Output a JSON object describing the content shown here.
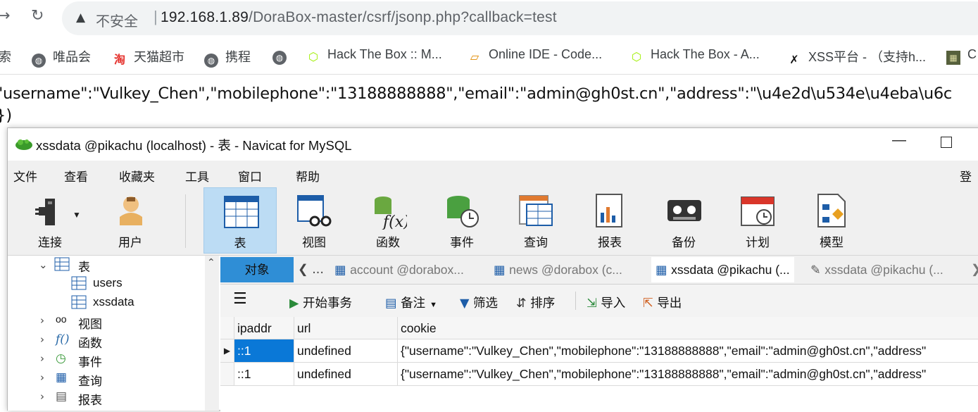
{
  "browser": {
    "back_icon": "arrow-right-icon",
    "insecure_label": "不安全",
    "url_host": "192.168.1.89",
    "url_path": "/DoraBox-master/csrf/jsonp.php?callback=test",
    "bookmarks": [
      {
        "label": "索",
        "icon": "none"
      },
      {
        "label": "唯品会",
        "icon": "globe-icon"
      },
      {
        "label": "天猫超市",
        "icon": "tmall-icon"
      },
      {
        "label": "携程",
        "icon": "globe-icon"
      },
      {
        "label": "",
        "icon": "globe-icon"
      },
      {
        "label": "Hack The Box :: M...",
        "icon": "htb-cube-icon"
      },
      {
        "label": "Online IDE - Code...",
        "icon": "ide-icon"
      },
      {
        "label": "Hack The Box - A...",
        "icon": "htb-cube-icon"
      },
      {
        "label": "XSS平台 - （支持h...",
        "icon": "xss-icon"
      },
      {
        "label": "C",
        "icon": "camo-icon"
      }
    ]
  },
  "response": {
    "line1": "\"username\":\"Vulkey_Chen\",\"mobilephone\":\"13188888888\",\"email\":\"admin@gh0st.cn\",\"address\":\"\\u4e2d\\u534e\\u4eba\\u6c",
    "line2": "})"
  },
  "navicat": {
    "title": "xssdata @pikachu (localhost) - 表 - Navicat for MySQL",
    "menus": [
      "文件",
      "查看",
      "收藏夹",
      "工具",
      "窗口",
      "帮助"
    ],
    "login": "登录",
    "toolbar": [
      "连接",
      "用户",
      "表",
      "视图",
      "函数",
      "事件",
      "查询",
      "报表",
      "备份",
      "计划",
      "模型"
    ],
    "tree": {
      "tables_label": "表",
      "tables": [
        "users",
        "xssdata"
      ],
      "groups": [
        "视图",
        "函数",
        "事件",
        "查询",
        "报表"
      ]
    },
    "tabs": {
      "objects": "对象",
      "items": [
        "account @dorabox...",
        "news @dorabox (c...",
        "xssdata @pikachu (...",
        "xssdata @pikachu (..."
      ]
    },
    "obj_toolbar": {
      "begin_tx": "开始事务",
      "note": "备注",
      "filter": "筛选",
      "sort": "排序",
      "import": "导入",
      "export": "导出"
    },
    "grid": {
      "columns": [
        "ipaddr",
        "url",
        "cookie"
      ],
      "rows": [
        {
          "ipaddr": "::1",
          "url": "undefined",
          "cookie": "{\"username\":\"Vulkey_Chen\",\"mobilephone\":\"13188888888\",\"email\":\"admin@gh0st.cn\",\"address\""
        },
        {
          "ipaddr": "::1",
          "url": "undefined",
          "cookie": "{\"username\":\"Vulkey_Chen\",\"mobilephone\":\"13188888888\",\"email\":\"admin@gh0st.cn\",\"address\""
        }
      ]
    }
  },
  "colors": {
    "selection": "#0a78d7",
    "objects_tab": "#2f8ed6",
    "toolbar_selected": "#bcdcf4"
  }
}
